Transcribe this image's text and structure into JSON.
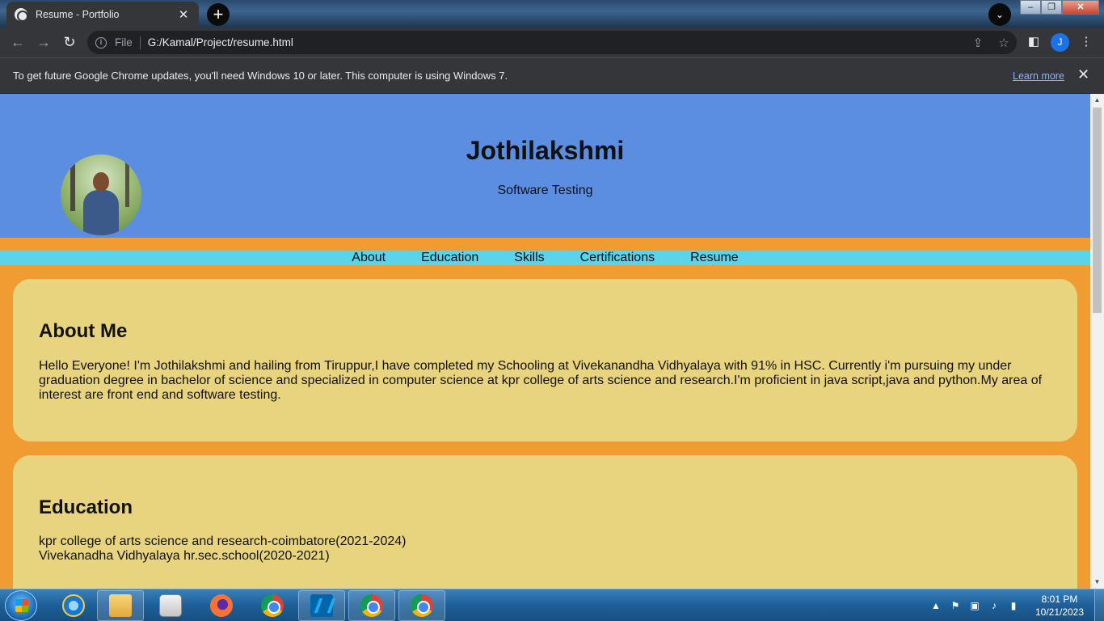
{
  "browser": {
    "tab_title": "Resume - Portfolio",
    "tab_close": "✕",
    "new_tab": "+",
    "tab_search": "⌄",
    "scheme_label": "File",
    "url": "G:/Kamal/Project/resume.html",
    "profile_initial": "J",
    "window_buttons": {
      "minimize": "–",
      "maximize": "❐",
      "close": "✕"
    }
  },
  "infobar": {
    "message": "To get future Google Chrome updates, you'll need Windows 10 or later. This computer is using Windows 7.",
    "link": "Learn more",
    "close": "✕"
  },
  "page": {
    "name": "Jothilakshmi",
    "role": "Software Testing",
    "nav": [
      "About",
      "Education",
      "Skills",
      "Certifications",
      "Resume"
    ],
    "about": {
      "heading": "About Me",
      "text": "Hello Everyone! I'm Jothilakshmi and hailing from Tiruppur,I have completed my Schooling at Vivekanandha Vidhyalaya with 91% in HSC. Currently i'm pursuing my under graduation degree in bachelor of science and specialized in computer science at kpr college of arts science and research.I'm proficient in java script,java and python.My area of interest are front end and software testing."
    },
    "education": {
      "heading": "Education",
      "lines": [
        "kpr college of arts science and research-coimbatore(2021-2024)",
        "Vivekanadha Vidhyalaya hr.sec.school(2020-2021)"
      ]
    }
  },
  "colors": {
    "hero": "#5b8de0",
    "page_bg": "#f19c33",
    "nav_band": "#5bd3ea",
    "card": "#e8d47e"
  },
  "taskbar": {
    "time": "8:01 PM",
    "date": "10/21/2023",
    "items": [
      "internet-explorer-icon",
      "file-explorer-icon",
      "media-player-icon",
      "firefox-icon",
      "chrome-icon",
      "vscode-icon",
      "chrome-icon",
      "chrome-profile-icon"
    ]
  }
}
